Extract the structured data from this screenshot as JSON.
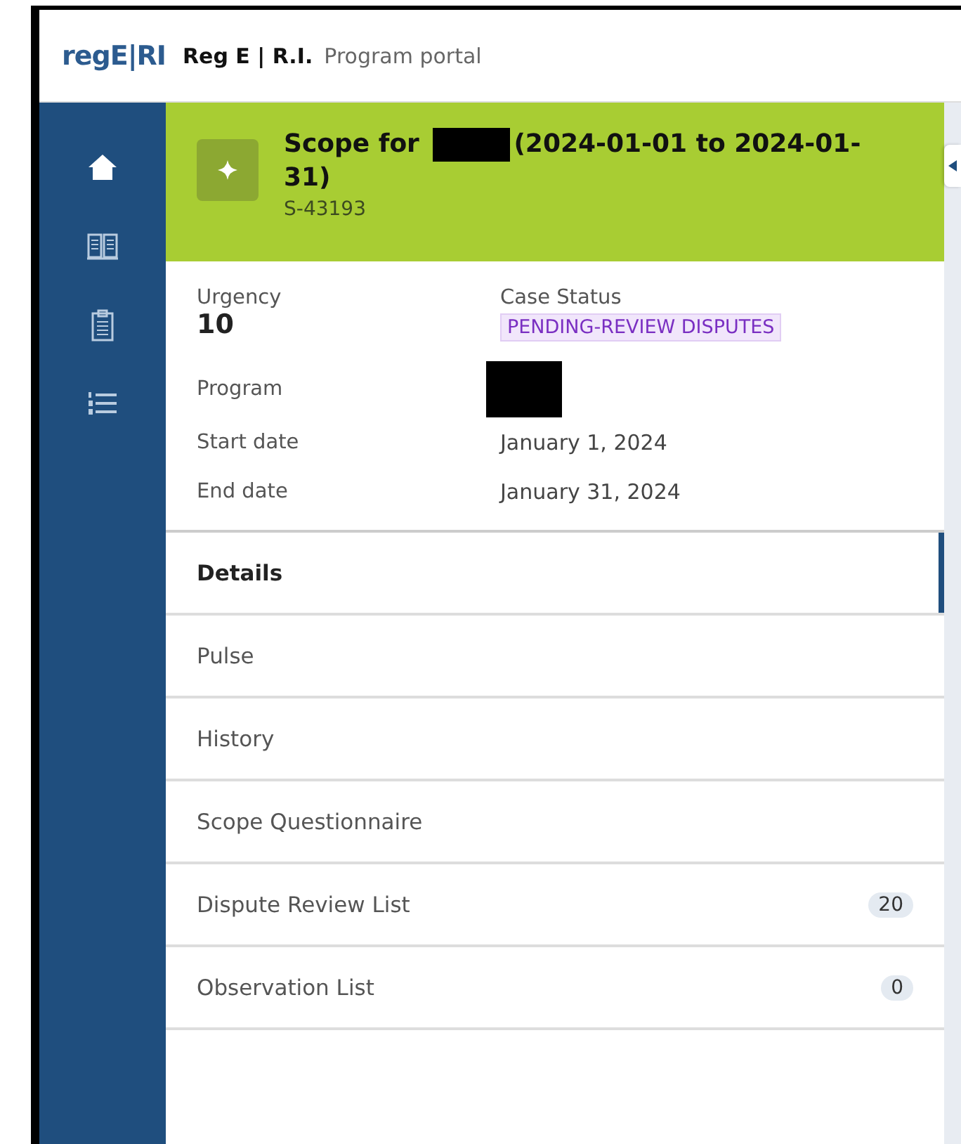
{
  "header": {
    "logo": "regE|RI",
    "app_name": "Reg E | R.I.",
    "portal": "Program portal"
  },
  "sidebar": {
    "items": [
      {
        "kind": "home",
        "selected": true
      },
      {
        "kind": "book",
        "selected": false
      },
      {
        "kind": "clipboard",
        "selected": false
      },
      {
        "kind": "list",
        "selected": false
      }
    ]
  },
  "case": {
    "title_before": "Scope for",
    "title_after": "(2024-01-01 to 2024-01-31)",
    "id": "S-43193"
  },
  "summary": {
    "urgency_label": "Urgency",
    "urgency": "10",
    "status_label": "Case Status",
    "status": "PENDING-REVIEW DISPUTES"
  },
  "fields": [
    {
      "label": "Program"
    },
    {
      "label": "Start date",
      "value": "January 1, 2024"
    },
    {
      "label": "End date",
      "value": "January 31, 2024"
    }
  ],
  "tabs": [
    {
      "label": "Details",
      "selected": true
    },
    {
      "label": "Pulse",
      "selected": false
    },
    {
      "label": "History",
      "selected": false
    },
    {
      "label": "Scope Questionnaire",
      "selected": false
    },
    {
      "label": "Dispute Review List",
      "selected": false,
      "count": "20"
    },
    {
      "label": "Observation List",
      "selected": false,
      "count": "0"
    }
  ]
}
